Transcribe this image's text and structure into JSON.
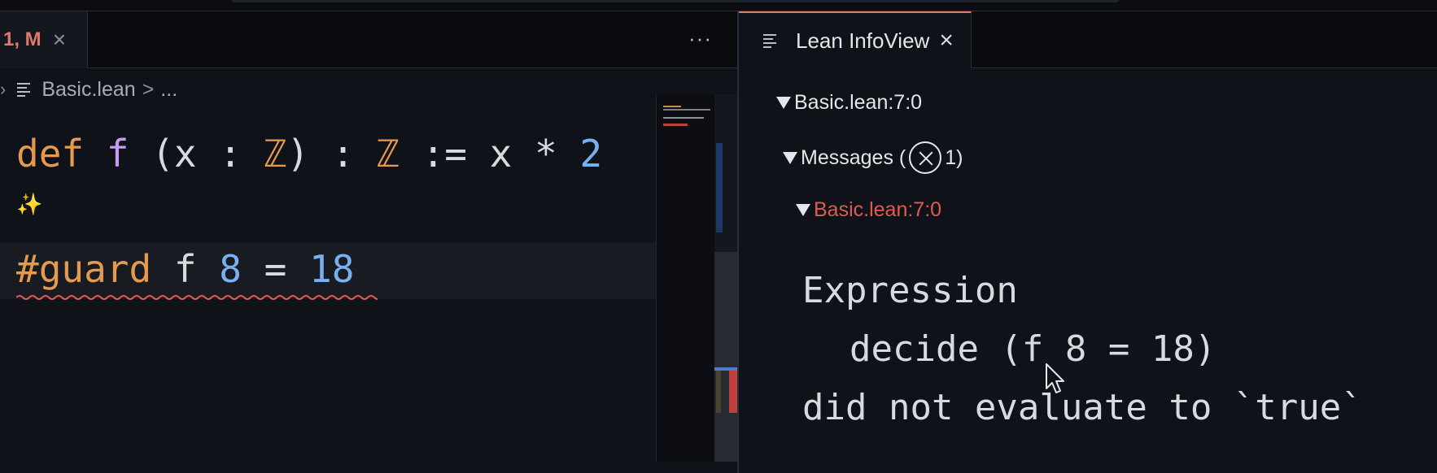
{
  "editor": {
    "tab": {
      "label": "1, M",
      "close": "×"
    },
    "more": "···",
    "breadcrumb": {
      "file": "Basic.lean",
      "sep": ">",
      "rest": "..."
    },
    "code": {
      "line1": [
        {
          "t": "def",
          "c": "kw"
        },
        {
          "t": " ",
          "c": "pl"
        },
        {
          "t": "f",
          "c": "fn"
        },
        {
          "t": " (x : ",
          "c": "pl"
        },
        {
          "t": "ℤ",
          "c": "ty"
        },
        {
          "t": ") : ",
          "c": "pl"
        },
        {
          "t": "ℤ",
          "c": "ty"
        },
        {
          "t": " := x * ",
          "c": "pl"
        },
        {
          "t": "2",
          "c": "num"
        }
      ],
      "sparkle": "✨",
      "line3": [
        {
          "t": "#guard",
          "c": "kw"
        },
        {
          "t": " f ",
          "c": "pl"
        },
        {
          "t": "8",
          "c": "num"
        },
        {
          "t": " = ",
          "c": "pl"
        },
        {
          "t": "18",
          "c": "num"
        }
      ]
    }
  },
  "infoview": {
    "tab": {
      "label": "Lean InfoView",
      "close": "×"
    },
    "location": "Basic.lean:7:0",
    "messages_label": "Messages (",
    "messages_count": "1)",
    "error_location": "Basic.lean:7:0",
    "message_lines": [
      "Expression",
      "decide (f 8 = 18)",
      "did not evaluate to `true`"
    ]
  },
  "colors": {
    "keyword": "#e69a4e",
    "function": "#c79bf2",
    "number": "#79b0f0",
    "error": "#e05a52",
    "accent": "#e0796a"
  }
}
